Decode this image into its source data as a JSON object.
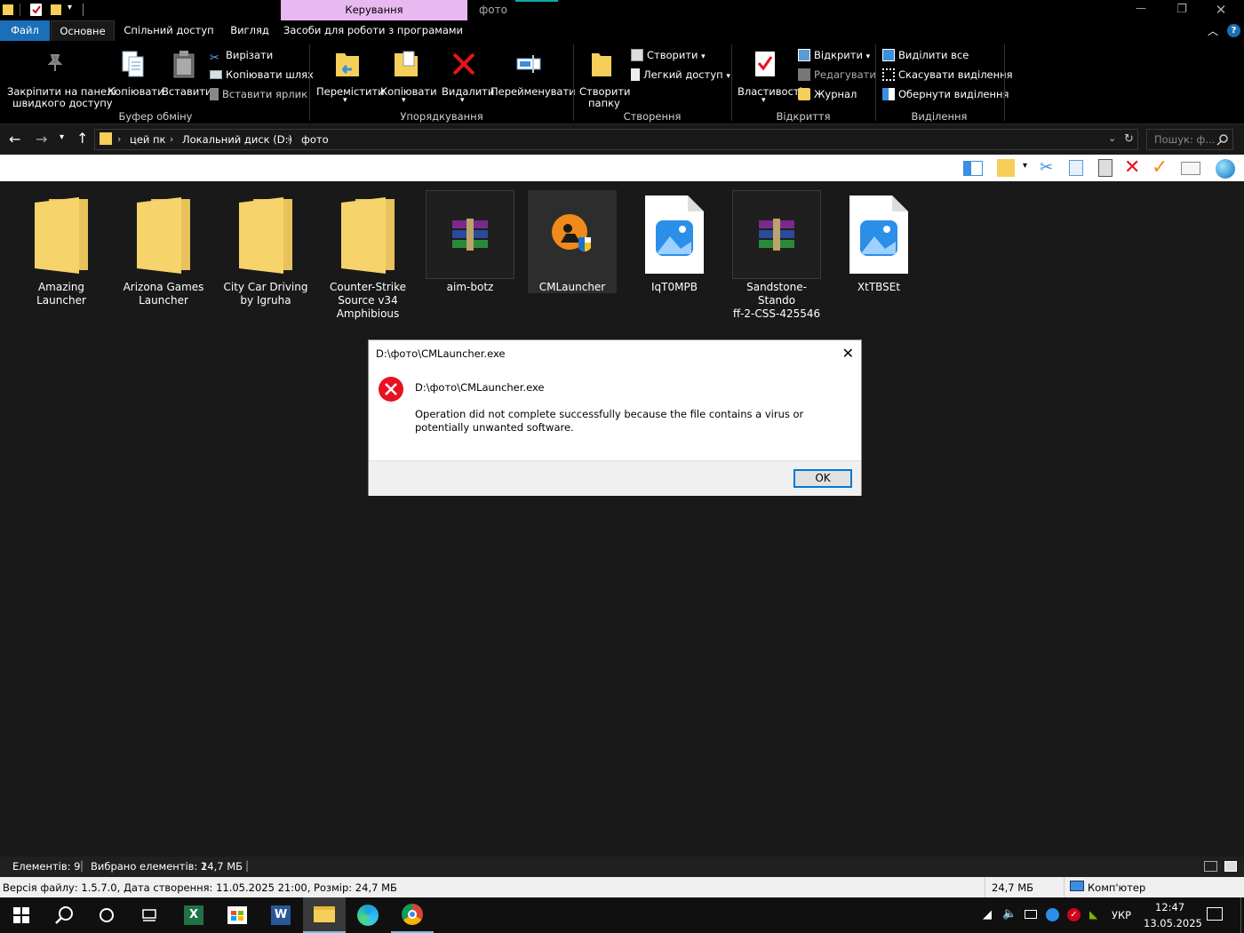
{
  "window": {
    "context_tab": "Керування",
    "folder_title": "фото"
  },
  "tabs": [
    "Файл",
    "Основне",
    "Спільний доступ",
    "Вигляд",
    "Засоби для роботи з програмами"
  ],
  "ribbon": {
    "pin_label_1": "Закріпити на панелі",
    "pin_label_2": "швидкого доступу",
    "copy": "Копіювати",
    "paste": "Вставити",
    "cut": "Вирізати",
    "copy_path": "Копіювати шлях",
    "paste_shortcut": "Вставити ярлик",
    "group_clipboard": "Буфер обміну",
    "move": "Перемістити",
    "copy_to": "Копіювати",
    "delete": "Видалити",
    "rename": "Перейменувати",
    "group_organize": "Упорядкування",
    "new_folder_1": "Створити",
    "new_folder_2": "папку",
    "new_item": "Створити",
    "easy_access": "Легкий доступ",
    "group_new": "Створення",
    "properties": "Властивості",
    "open": "Відкрити",
    "edit": "Редагувати",
    "history": "Журнал",
    "group_open": "Відкриття",
    "select_all": "Виділити все",
    "select_none": "Скасувати виділення",
    "invert": "Обернути виділення",
    "group_select": "Виділення"
  },
  "address": {
    "crumbs": [
      "цей пк",
      "Локальний диск (D:)",
      "фото"
    ],
    "search_placeholder": "Пошук: ф..."
  },
  "files": [
    {
      "name_1": "Amazing",
      "name_2": "Launcher",
      "name_3": "",
      "type": "folder"
    },
    {
      "name_1": "Arizona Games",
      "name_2": "Launcher",
      "name_3": "",
      "type": "folder"
    },
    {
      "name_1": "City Car Driving",
      "name_2": "by Igruha",
      "name_3": "",
      "type": "folder"
    },
    {
      "name_1": "Counter-Strike",
      "name_2": "Source v34",
      "name_3": "Amphibious",
      "type": "folder"
    },
    {
      "name_1": "aim-botz",
      "name_2": "",
      "name_3": "",
      "type": "archive"
    },
    {
      "name_1": "CMLauncher",
      "name_2": "",
      "name_3": "",
      "type": "exe"
    },
    {
      "name_1": "IqT0MPB",
      "name_2": "",
      "name_3": "",
      "type": "image"
    },
    {
      "name_1": "Sandstone-Stando",
      "name_2": "ff-2-CSS-425546",
      "name_3": "",
      "type": "archive"
    },
    {
      "name_1": "XtTBSEt",
      "name_2": "",
      "name_3": "",
      "type": "image"
    }
  ],
  "dialog": {
    "title": "D:\\фото\\CMLauncher.exe",
    "path": "D:\\фото\\CMLauncher.exe",
    "message": "Operation did not complete successfully because the file contains a virus or potentially unwanted software.",
    "ok": "OK"
  },
  "status": {
    "items": "Елементів: 9",
    "selected": "Вибрано елементів: 1",
    "size": "24,7 МБ"
  },
  "details": {
    "info": "Версія файлу: 1.5.7.0, Дата створення: 11.05.2025 21:00, Розмір: 24,7 МБ",
    "size": "24,7 МБ",
    "location": "Комп'ютер"
  },
  "taskbar": {
    "lang": "УКР",
    "time": "12:47",
    "date": "13.05.2025"
  },
  "colors": {
    "accent": "#0078d7",
    "file_tab": "#1a6fb8",
    "context_tab": "#e8b8f0",
    "error_red": "#e81123"
  }
}
